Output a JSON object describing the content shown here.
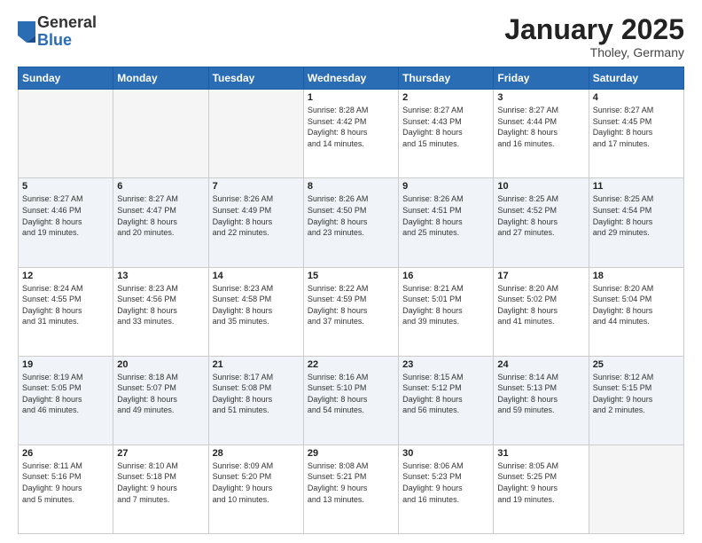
{
  "logo": {
    "general": "General",
    "blue": "Blue"
  },
  "header": {
    "month": "January 2025",
    "location": "Tholey, Germany"
  },
  "weekdays": [
    "Sunday",
    "Monday",
    "Tuesday",
    "Wednesday",
    "Thursday",
    "Friday",
    "Saturday"
  ],
  "rows": [
    [
      {
        "day": "",
        "info": ""
      },
      {
        "day": "",
        "info": ""
      },
      {
        "day": "",
        "info": ""
      },
      {
        "day": "1",
        "info": "Sunrise: 8:28 AM\nSunset: 4:42 PM\nDaylight: 8 hours\nand 14 minutes."
      },
      {
        "day": "2",
        "info": "Sunrise: 8:27 AM\nSunset: 4:43 PM\nDaylight: 8 hours\nand 15 minutes."
      },
      {
        "day": "3",
        "info": "Sunrise: 8:27 AM\nSunset: 4:44 PM\nDaylight: 8 hours\nand 16 minutes."
      },
      {
        "day": "4",
        "info": "Sunrise: 8:27 AM\nSunset: 4:45 PM\nDaylight: 8 hours\nand 17 minutes."
      }
    ],
    [
      {
        "day": "5",
        "info": "Sunrise: 8:27 AM\nSunset: 4:46 PM\nDaylight: 8 hours\nand 19 minutes."
      },
      {
        "day": "6",
        "info": "Sunrise: 8:27 AM\nSunset: 4:47 PM\nDaylight: 8 hours\nand 20 minutes."
      },
      {
        "day": "7",
        "info": "Sunrise: 8:26 AM\nSunset: 4:49 PM\nDaylight: 8 hours\nand 22 minutes."
      },
      {
        "day": "8",
        "info": "Sunrise: 8:26 AM\nSunset: 4:50 PM\nDaylight: 8 hours\nand 23 minutes."
      },
      {
        "day": "9",
        "info": "Sunrise: 8:26 AM\nSunset: 4:51 PM\nDaylight: 8 hours\nand 25 minutes."
      },
      {
        "day": "10",
        "info": "Sunrise: 8:25 AM\nSunset: 4:52 PM\nDaylight: 8 hours\nand 27 minutes."
      },
      {
        "day": "11",
        "info": "Sunrise: 8:25 AM\nSunset: 4:54 PM\nDaylight: 8 hours\nand 29 minutes."
      }
    ],
    [
      {
        "day": "12",
        "info": "Sunrise: 8:24 AM\nSunset: 4:55 PM\nDaylight: 8 hours\nand 31 minutes."
      },
      {
        "day": "13",
        "info": "Sunrise: 8:23 AM\nSunset: 4:56 PM\nDaylight: 8 hours\nand 33 minutes."
      },
      {
        "day": "14",
        "info": "Sunrise: 8:23 AM\nSunset: 4:58 PM\nDaylight: 8 hours\nand 35 minutes."
      },
      {
        "day": "15",
        "info": "Sunrise: 8:22 AM\nSunset: 4:59 PM\nDaylight: 8 hours\nand 37 minutes."
      },
      {
        "day": "16",
        "info": "Sunrise: 8:21 AM\nSunset: 5:01 PM\nDaylight: 8 hours\nand 39 minutes."
      },
      {
        "day": "17",
        "info": "Sunrise: 8:20 AM\nSunset: 5:02 PM\nDaylight: 8 hours\nand 41 minutes."
      },
      {
        "day": "18",
        "info": "Sunrise: 8:20 AM\nSunset: 5:04 PM\nDaylight: 8 hours\nand 44 minutes."
      }
    ],
    [
      {
        "day": "19",
        "info": "Sunrise: 8:19 AM\nSunset: 5:05 PM\nDaylight: 8 hours\nand 46 minutes."
      },
      {
        "day": "20",
        "info": "Sunrise: 8:18 AM\nSunset: 5:07 PM\nDaylight: 8 hours\nand 49 minutes."
      },
      {
        "day": "21",
        "info": "Sunrise: 8:17 AM\nSunset: 5:08 PM\nDaylight: 8 hours\nand 51 minutes."
      },
      {
        "day": "22",
        "info": "Sunrise: 8:16 AM\nSunset: 5:10 PM\nDaylight: 8 hours\nand 54 minutes."
      },
      {
        "day": "23",
        "info": "Sunrise: 8:15 AM\nSunset: 5:12 PM\nDaylight: 8 hours\nand 56 minutes."
      },
      {
        "day": "24",
        "info": "Sunrise: 8:14 AM\nSunset: 5:13 PM\nDaylight: 8 hours\nand 59 minutes."
      },
      {
        "day": "25",
        "info": "Sunrise: 8:12 AM\nSunset: 5:15 PM\nDaylight: 9 hours\nand 2 minutes."
      }
    ],
    [
      {
        "day": "26",
        "info": "Sunrise: 8:11 AM\nSunset: 5:16 PM\nDaylight: 9 hours\nand 5 minutes."
      },
      {
        "day": "27",
        "info": "Sunrise: 8:10 AM\nSunset: 5:18 PM\nDaylight: 9 hours\nand 7 minutes."
      },
      {
        "day": "28",
        "info": "Sunrise: 8:09 AM\nSunset: 5:20 PM\nDaylight: 9 hours\nand 10 minutes."
      },
      {
        "day": "29",
        "info": "Sunrise: 8:08 AM\nSunset: 5:21 PM\nDaylight: 9 hours\nand 13 minutes."
      },
      {
        "day": "30",
        "info": "Sunrise: 8:06 AM\nSunset: 5:23 PM\nDaylight: 9 hours\nand 16 minutes."
      },
      {
        "day": "31",
        "info": "Sunrise: 8:05 AM\nSunset: 5:25 PM\nDaylight: 9 hours\nand 19 minutes."
      },
      {
        "day": "",
        "info": ""
      }
    ]
  ]
}
